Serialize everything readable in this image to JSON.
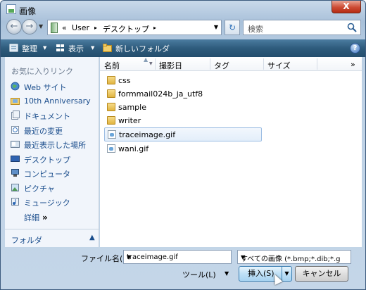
{
  "window": {
    "title": "画像",
    "close_label": "X"
  },
  "nav": {
    "back_label": "←",
    "forward_label": "→",
    "address": {
      "root": "«",
      "segments": [
        "User",
        "デスクトップ"
      ],
      "sep": "▸"
    },
    "search_placeholder": "検索"
  },
  "toolbar": {
    "organize": "整理",
    "view": "表示",
    "new_folder": "新しいフォルダ",
    "help": "?"
  },
  "sidebar": {
    "title": "お気に入りリンク",
    "items": [
      {
        "label": "Web サイト",
        "icon": "globe-icon"
      },
      {
        "label": "10th Anniversary",
        "icon": "image-folder-icon"
      },
      {
        "label": "ドキュメント",
        "icon": "documents-icon"
      },
      {
        "label": "最近の変更",
        "icon": "recent-changes-icon"
      },
      {
        "label": "最近表示した場所",
        "icon": "recent-places-icon"
      },
      {
        "label": "デスクトップ",
        "icon": "desktop-icon"
      },
      {
        "label": "コンピュータ",
        "icon": "computer-icon"
      },
      {
        "label": "ピクチャ",
        "icon": "pictures-icon"
      },
      {
        "label": "ミュージック",
        "icon": "music-icon"
      }
    ],
    "more": "詳細",
    "more_arrow": "»",
    "folder_label": "フォルダ",
    "folder_arrow": "▲"
  },
  "columns": [
    "名前",
    "撮影日",
    "タグ",
    "サイズ"
  ],
  "columns_more": "»",
  "files": [
    {
      "name": "css",
      "type": "folder"
    },
    {
      "name": "formmail024b_ja_utf8",
      "type": "folder"
    },
    {
      "name": "sample",
      "type": "folder"
    },
    {
      "name": "writer",
      "type": "folder"
    },
    {
      "name": "traceimage.gif",
      "type": "gif",
      "selected": true
    },
    {
      "name": "wani.gif",
      "type": "gif"
    }
  ],
  "footer": {
    "filename_label": "ファイル名(N):",
    "filename_value": "traceimage.gif",
    "filter_value": "すべての画像 (*.bmp;*.dib;*.gif;*.jpg",
    "tools": "ツール(L)",
    "insert": "挿入(S)",
    "cancel": "キャンセル"
  }
}
